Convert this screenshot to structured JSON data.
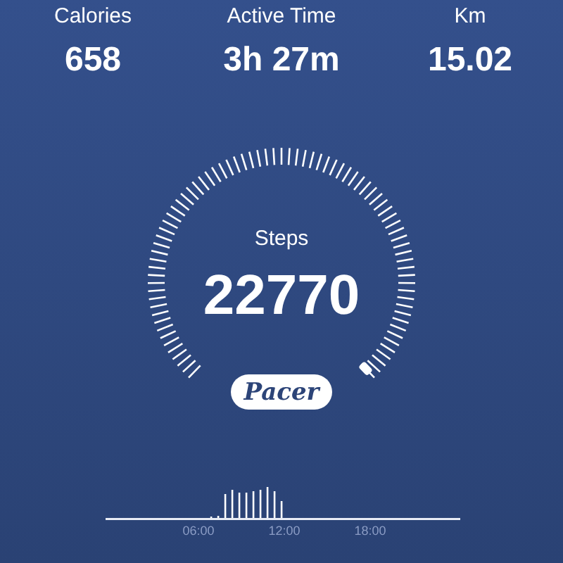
{
  "stats": [
    {
      "label": "Calories",
      "value": "658"
    },
    {
      "label": "Active Time",
      "value": "3h 27m"
    },
    {
      "label": "Km",
      "value": "15.02"
    }
  ],
  "gauge": {
    "label": "Steps",
    "value": "22770"
  },
  "brand": "Pacer",
  "activity": {
    "time_labels": [
      "06:00",
      "12:00",
      "18:00"
    ]
  }
}
